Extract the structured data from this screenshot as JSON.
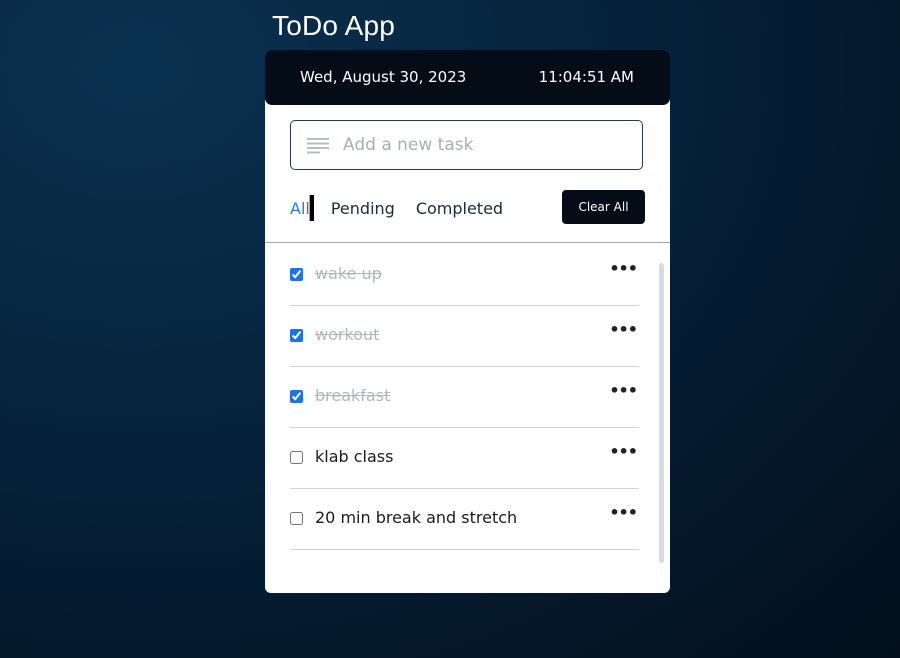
{
  "app": {
    "title": "ToDo App"
  },
  "header": {
    "date": "Wed, August 30, 2023",
    "time": "11:04:51 AM"
  },
  "input": {
    "placeholder": "Add a new task",
    "value": "",
    "icon": "lines-icon"
  },
  "filters": {
    "all": "All",
    "pending": "Pending",
    "completed": "Completed",
    "active": "All"
  },
  "clear_button": {
    "label": "Clear All"
  },
  "tasks": [
    {
      "text": "wake up",
      "completed": true
    },
    {
      "text": "workout",
      "completed": true
    },
    {
      "text": "breakfast",
      "completed": true
    },
    {
      "text": "klab class",
      "completed": false
    },
    {
      "text": "20 min break and stretch",
      "completed": false
    }
  ],
  "task_menu_icon": "more-horizontal-icon",
  "colors": {
    "accent": "#2a7bd3",
    "header_bg": "#040d17",
    "completed_text": "#b3b7bb"
  }
}
